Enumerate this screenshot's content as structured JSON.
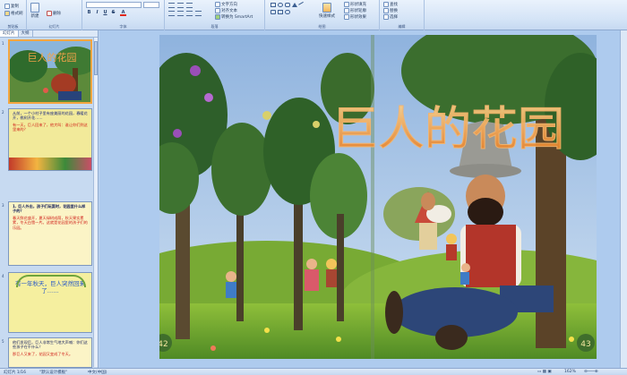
{
  "ribbon": {
    "clipboard_label": "剪贴板",
    "copy_label": "复制",
    "format_painter_label": "格式刷",
    "slides_group_label": "幻灯片",
    "new_slide_label": "新建",
    "delete_label": "删除",
    "font_group_label": "字体",
    "paragraph_group_label": "段落",
    "text_direction_label": "文字方向",
    "align_text_label": "对齐文本",
    "smartart_label": "转换为 SmartArt",
    "drawing_group_label": "绘图",
    "quick_styles_label": "快速样式",
    "shape_fill_label": "形状填充",
    "shape_outline_label": "形状轮廓",
    "shape_effects_label": "形状效果",
    "editing_group_label": "编辑",
    "find_label": "查找",
    "replace_label": "替换",
    "select_label": "选择"
  },
  "panel": {
    "tab_slides": "幻灯片",
    "tab_outline": "大纲"
  },
  "slides": [
    {
      "number": "1",
      "kind": "picture"
    },
    {
      "number": "2",
      "text_a": "从前，一个小村子里有座美丽的花园，春暖花开，桃树开花……",
      "text_b": "有一天，巨人回来了，他大叫：谁让你们到这里来的？",
      "bg": "#f2ea9a"
    },
    {
      "number": "3",
      "title": "1. 巨人外出，孩子们玩耍时，花园里什么样子的？",
      "text": "春天鲜花盛开，夏天绿树成荫，秋天果实累累，冬天白雪一片。这就是花园里的孩子们的乐园。",
      "bg": "#fbf4c6"
    },
    {
      "number": "4",
      "text": "有一年秋天，巨人突然回来了……",
      "bg": "#f5ef9f"
    },
    {
      "number": "5",
      "text_a": "他们发现后，巨人非常生气地大声喊：你们这些孩子在干什么？",
      "text_b": "那巨人又来了，花园又变成了冬天。",
      "bg": "#fbf4c6"
    }
  ],
  "slide_main": {
    "title": "巨人的花园",
    "page_left": "42",
    "page_right": "43"
  },
  "status": {
    "slide_info": "幻灯片 1/16",
    "theme": "\"默认设计模板\"",
    "language": "中文(中国)",
    "zoom": "162%"
  },
  "colors": {
    "ribbon_bg": "#d3e3f6",
    "pane_bg": "#c7daf1",
    "selection": "#f4a640",
    "title_gradient_top": "#f8c070",
    "title_gradient_bottom": "#e8791c"
  }
}
